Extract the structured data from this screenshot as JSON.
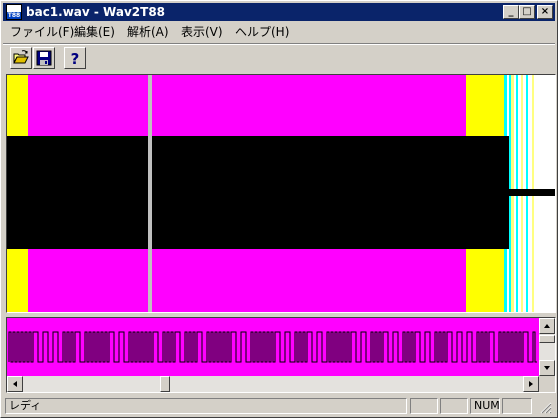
{
  "window": {
    "title": "bac1.wav - Wav2T88",
    "icon_label": "T88",
    "controls": {
      "minimize": "_",
      "maximize": "□",
      "close": "×"
    }
  },
  "menu": [
    {
      "label": "ファイル(F)"
    },
    {
      "label": "編集(E)"
    },
    {
      "label": "解析(A)"
    },
    {
      "label": "表示(V)"
    },
    {
      "label": "ヘルプ(H)"
    }
  ],
  "toolbar": {
    "buttons": [
      {
        "name": "open",
        "icon": "open-folder-icon"
      },
      {
        "name": "save",
        "icon": "floppy-disk-icon"
      },
      {
        "name": "help",
        "icon": "help-question-icon",
        "glyph": "?"
      }
    ]
  },
  "waveform": {
    "background_color": "#ff00ff",
    "marker_color": "#ffff00",
    "signal_color": "#000000",
    "cursor_color": "#c0c0c0",
    "tail_colors": [
      "#00ffff",
      "#ffffff",
      "#ffff00"
    ]
  },
  "detail_view": {
    "background_color": "#ff00ff",
    "signal_color": "#000000"
  },
  "horizontal_scroll": {
    "position": 0.28
  },
  "vertical_scroll": {
    "position": 0.0
  },
  "status": {
    "text": "レディ",
    "panels": [
      "",
      "",
      "NUM",
      "",
      ""
    ]
  }
}
